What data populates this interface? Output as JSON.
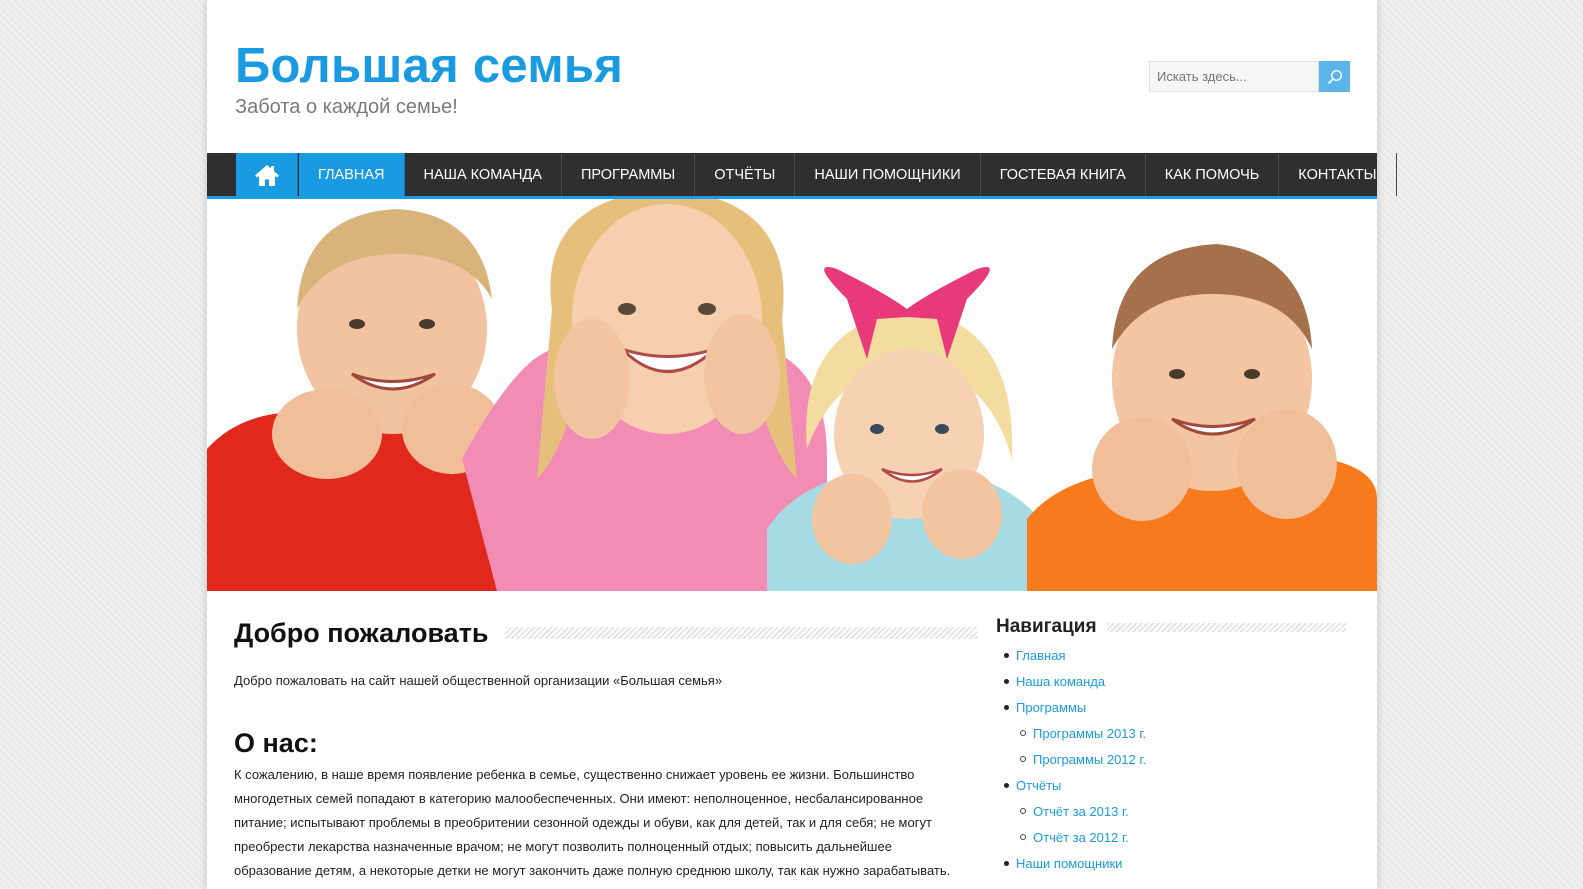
{
  "header": {
    "site_title": "Большая семья",
    "site_description": "Забота о каждой семье!"
  },
  "search": {
    "placeholder": "Искать здесь..."
  },
  "icons": {
    "home": "home-icon",
    "search": "search-icon"
  },
  "colors": {
    "accent": "#1a9ae0",
    "nav_background": "#2f2f2f"
  },
  "nav": {
    "items": [
      {
        "label": "ГЛАВНАЯ",
        "active": true
      },
      {
        "label": "НАША КОМАНДА"
      },
      {
        "label": "ПРОГРАММЫ"
      },
      {
        "label": "ОТЧЁТЫ"
      },
      {
        "label": "НАШИ ПОМОЩНИКИ"
      },
      {
        "label": "ГОСТЕВАЯ КНИГА"
      },
      {
        "label": "КАК ПОМОЧЬ"
      },
      {
        "label": "КОНТАКТЫ"
      }
    ]
  },
  "main": {
    "title": "Добро пожаловать",
    "intro": "Добро пожаловать на сайт нашей общественной организации «Большая семья»",
    "about_title": "О нас:",
    "about_lines": [
      "К сожалению, в наше время появление ребенка в семье, существенно снижает уровень ее жизни. Большинство",
      "многодетных семей попадают в категорию малообеспеченных. Они имеют: неполноценное, несбалансированное",
      "питание; испытывают проблемы в преобритении сезонной одежды и обуви, как для детей, так и для себя; не могут",
      "преобрести лекарства назначенные врачом; не могут позволить  полноценный отдых; повысить дальнейшее",
      "образование детям, а некоторые детки не могут закончить даже полную среднюю школу, так как нужно зарабатывать."
    ]
  },
  "sidebar": {
    "title": "Навигация",
    "items": [
      {
        "label": "Главная"
      },
      {
        "label": "Наша команда"
      },
      {
        "label": "Программы"
      },
      {
        "label": "Программы 2013 г."
      },
      {
        "label": "Программы 2012 г."
      },
      {
        "label": "Отчёты"
      },
      {
        "label": "Отчёт за 2013 г."
      },
      {
        "label": "Отчёт за 2012 г."
      },
      {
        "label": "Наши помощники"
      }
    ]
  }
}
